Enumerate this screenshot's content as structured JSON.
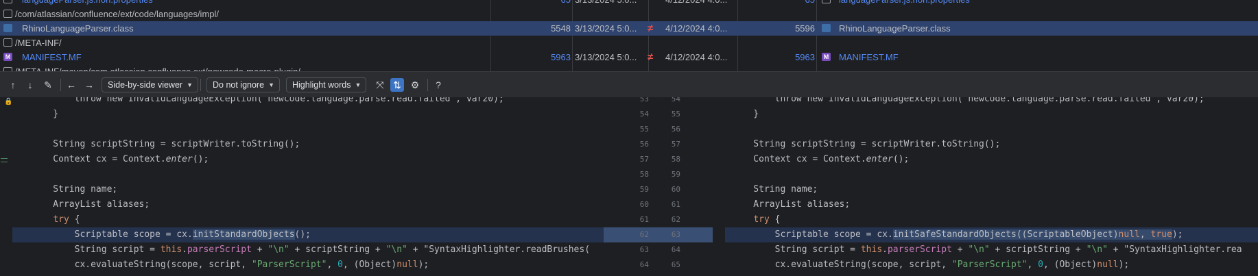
{
  "file_list": {
    "rows": [
      {
        "type": "file",
        "icon": "properties-file-icon",
        "name": "languageParser.js.non.properties",
        "left_size": "65",
        "left_date": "3/13/2024 5:0...",
        "right_date": "4/12/2024 4:0...",
        "right_size": "65",
        "right_name": "languageParser.js.non.properties",
        "diff": "",
        "selected": false,
        "blue": true
      },
      {
        "type": "folder",
        "path": "/com/atlassian/confluence/ext/code/languages/impl/"
      },
      {
        "type": "file",
        "icon": "class-file-icon",
        "name": "RhinoLanguageParser.class",
        "left_size": "5548",
        "left_date": "3/13/2024 5:0...",
        "right_date": "4/12/2024 4:0...",
        "right_size": "5596",
        "right_name": "RhinoLanguageParser.class",
        "diff": "≠",
        "selected": true,
        "blue": false
      },
      {
        "type": "folder",
        "path": "/META-INF/"
      },
      {
        "type": "file",
        "icon": "manifest-file-icon",
        "name": "MANIFEST.MF",
        "left_size": "5963",
        "left_date": "3/13/2024 5:0...",
        "right_date": "4/12/2024 4:0...",
        "right_size": "5963",
        "right_name": "MANIFEST.MF",
        "diff": "≠",
        "selected": false,
        "blue": true
      },
      {
        "type": "folder",
        "path": "/META-INF/maven/com.atlassian.confluence.ext/newcode-macro-plugin/"
      }
    ]
  },
  "toolbar": {
    "viewer": "Side-by-side viewer",
    "ignore": "Do not ignore",
    "highlight": "Highlight words",
    "help": "?"
  },
  "left_code": [
    {
      "n": "53",
      "parts": [
        [
          "        throw new InvalidLanguageException(\"newcode.language.parse.read.failed\", var20);",
          ""
        ]
      ]
    },
    {
      "n": "54",
      "parts": [
        [
          "    }",
          ""
        ]
      ]
    },
    {
      "n": "55",
      "parts": [
        [
          "",
          ""
        ]
      ]
    },
    {
      "n": "56",
      "parts": [
        [
          "    String scriptString = scriptWriter.toString();",
          ""
        ]
      ]
    },
    {
      "n": "57",
      "parts": [
        [
          "    Context cx = Context.",
          ""
        ],
        [
          "enter",
          "it"
        ],
        [
          "();",
          ""
        ]
      ]
    },
    {
      "n": "58",
      "parts": [
        [
          "",
          ""
        ]
      ]
    },
    {
      "n": "59",
      "parts": [
        [
          "    String name;",
          ""
        ]
      ]
    },
    {
      "n": "60",
      "parts": [
        [
          "    ArrayList aliases;",
          ""
        ]
      ]
    },
    {
      "n": "61",
      "parts": [
        [
          "    ",
          "",
          ""
        ],
        [
          "try",
          "kw"
        ],
        [
          " {",
          ""
        ]
      ]
    },
    {
      "n": "62",
      "parts": [
        [
          "        Scriptable scope = cx.",
          ""
        ],
        [
          "initStandardObjects",
          "hl-word"
        ],
        [
          "();",
          ""
        ]
      ]
    },
    {
      "n": "63",
      "parts": [
        [
          "        String script = ",
          ""
        ],
        [
          "this",
          "kw"
        ],
        [
          ".",
          ""
        ],
        [
          "parserScript",
          "fld"
        ],
        [
          " + ",
          ""
        ],
        [
          "\"\\n\"",
          "str"
        ],
        [
          " + scriptString + ",
          ""
        ],
        [
          "\"\\n\"",
          "str"
        ],
        [
          " + ",
          ""
        ],
        [
          "\"SyntaxHighlighter.readBrushes(",
          ""
        ]
      ]
    },
    {
      "n": "64",
      "parts": [
        [
          "        cx.evaluateString(scope, script, ",
          ""
        ],
        [
          "\"ParserScript\"",
          "str"
        ],
        [
          ", ",
          ""
        ],
        [
          "0",
          "num"
        ],
        [
          ", (Object)",
          ""
        ],
        [
          "null",
          "kw"
        ],
        [
          ");",
          ""
        ]
      ]
    }
  ],
  "right_code": [
    {
      "n": "54",
      "parts": [
        [
          "        throw new InvalidLanguageException(\"newcode.language.parse.read.failed\", var20);",
          ""
        ]
      ]
    },
    {
      "n": "55",
      "parts": [
        [
          "    }",
          ""
        ]
      ]
    },
    {
      "n": "56",
      "parts": [
        [
          "",
          ""
        ]
      ]
    },
    {
      "n": "57",
      "parts": [
        [
          "    String scriptString = scriptWriter.toString();",
          ""
        ]
      ]
    },
    {
      "n": "58",
      "parts": [
        [
          "    Context cx = Context.",
          ""
        ],
        [
          "enter",
          "it"
        ],
        [
          "();",
          ""
        ]
      ]
    },
    {
      "n": "59",
      "parts": [
        [
          "",
          ""
        ]
      ]
    },
    {
      "n": "60",
      "parts": [
        [
          "    String name;",
          ""
        ]
      ]
    },
    {
      "n": "61",
      "parts": [
        [
          "    ArrayList aliases;",
          ""
        ]
      ]
    },
    {
      "n": "62",
      "parts": [
        [
          "    ",
          "",
          ""
        ],
        [
          "try",
          "kw"
        ],
        [
          " {",
          ""
        ]
      ]
    },
    {
      "n": "63",
      "parts": [
        [
          "        Scriptable scope = cx.",
          ""
        ],
        [
          "initSafeStandardObjects((ScriptableObject)",
          "hl-word"
        ],
        [
          "null",
          "kw hl-word"
        ],
        [
          ", ",
          "hl-word"
        ],
        [
          "true",
          "kw hl-word"
        ],
        [
          ");",
          ""
        ]
      ]
    },
    {
      "n": "64",
      "parts": [
        [
          "        String script = ",
          ""
        ],
        [
          "this",
          "kw"
        ],
        [
          ".",
          ""
        ],
        [
          "parserScript",
          "fld"
        ],
        [
          " + ",
          ""
        ],
        [
          "\"\\n\"",
          "str"
        ],
        [
          " + scriptString + ",
          ""
        ],
        [
          "\"\\n\"",
          "str"
        ],
        [
          " + ",
          ""
        ],
        [
          "\"SyntaxHighlighter.rea",
          ""
        ]
      ]
    },
    {
      "n": "65",
      "parts": [
        [
          "        cx.evaluateString(scope, script, ",
          ""
        ],
        [
          "\"ParserScript\"",
          "str"
        ],
        [
          ", ",
          ""
        ],
        [
          "0",
          "num"
        ],
        [
          ", (Object)",
          ""
        ],
        [
          "null",
          "kw"
        ],
        [
          ");",
          ""
        ]
      ]
    }
  ],
  "colors": {
    "selection": "#2e436e",
    "modified_band": "#25324d",
    "accent": "#3d74c4",
    "diff_marker": "#e5524e"
  }
}
